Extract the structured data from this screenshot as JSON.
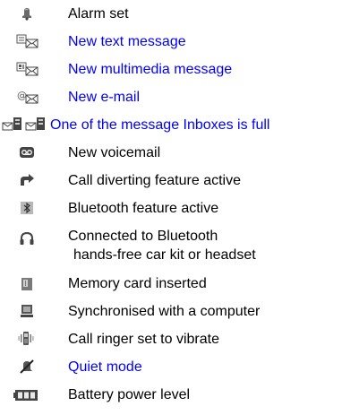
{
  "items": [
    {
      "icon": "alarm-icon",
      "label": "Alarm set",
      "link": false
    },
    {
      "icon": "text-message-icon",
      "label": "New text message",
      "link": true
    },
    {
      "icon": "multimedia-message-icon",
      "label": "New multimedia message",
      "link": true
    },
    {
      "icon": "email-icon",
      "label": "New e-mail",
      "link": true
    },
    {
      "icon": "inbox-full-icon",
      "label": "One of the message Inboxes is full",
      "link": true
    },
    {
      "icon": "voicemail-icon",
      "label": "New voicemail",
      "link": false
    },
    {
      "icon": "call-divert-icon",
      "label": "Call diverting feature active",
      "link": false
    },
    {
      "icon": "bluetooth-icon",
      "label": "Bluetooth feature active",
      "link": false
    },
    {
      "icon": "headset-icon",
      "label": "Connected to Bluetooth",
      "label2": "hands-free car kit or headset",
      "link": false
    },
    {
      "icon": "memory-card-icon",
      "label": "Memory card inserted",
      "link": false
    },
    {
      "icon": "computer-sync-icon",
      "label": "Synchronised with a computer",
      "link": false
    },
    {
      "icon": "vibrate-icon",
      "label": "Call ringer set to vibrate",
      "link": false
    },
    {
      "icon": "quiet-mode-icon",
      "label": "Quiet mode",
      "link": true
    },
    {
      "icon": "battery-icon",
      "label": "Battery power level",
      "link": false
    }
  ],
  "colors": {
    "link": "#0000ff",
    "text": "#000000"
  }
}
